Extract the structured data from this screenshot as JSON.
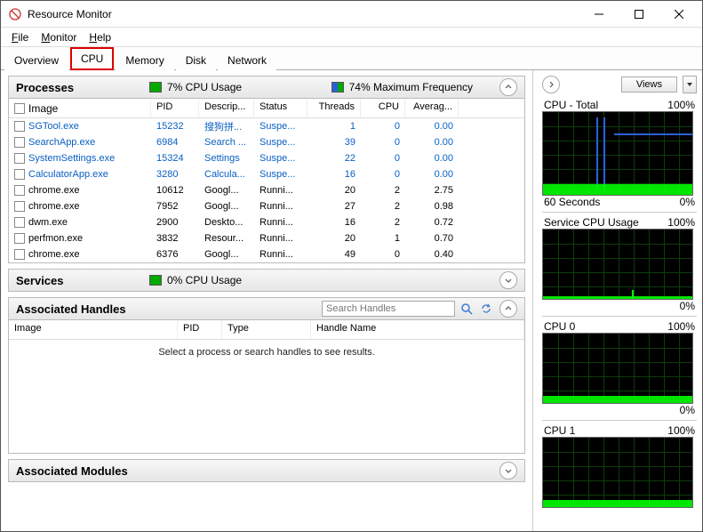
{
  "window": {
    "title": "Resource Monitor"
  },
  "menubar": {
    "file": "File",
    "monitor": "Monitor",
    "help": "Help"
  },
  "tabs": {
    "overview": "Overview",
    "cpu": "CPU",
    "memory": "Memory",
    "disk": "Disk",
    "network": "Network",
    "active": "cpu"
  },
  "processes": {
    "title": "Processes",
    "cpu_usage": "7% CPU Usage",
    "max_freq": "74% Maximum Frequency",
    "columns": {
      "image": "Image",
      "pid": "PID",
      "desc": "Descrip...",
      "status": "Status",
      "threads": "Threads",
      "cpu": "CPU",
      "avg": "Averag..."
    },
    "rows": [
      {
        "image": "SGTool.exe",
        "pid": "15232",
        "desc": "搜狗拼...",
        "status": "Suspe...",
        "threads": "1",
        "cpu": "0",
        "avg": "0.00",
        "blue": true
      },
      {
        "image": "SearchApp.exe",
        "pid": "6984",
        "desc": "Search ...",
        "status": "Suspe...",
        "threads": "39",
        "cpu": "0",
        "avg": "0.00",
        "blue": true
      },
      {
        "image": "SystemSettings.exe",
        "pid": "15324",
        "desc": "Settings",
        "status": "Suspe...",
        "threads": "22",
        "cpu": "0",
        "avg": "0.00",
        "blue": true
      },
      {
        "image": "CalculatorApp.exe",
        "pid": "3280",
        "desc": "Calcula...",
        "status": "Suspe...",
        "threads": "16",
        "cpu": "0",
        "avg": "0.00",
        "blue": true
      },
      {
        "image": "chrome.exe",
        "pid": "10612",
        "desc": "Googl...",
        "status": "Runni...",
        "threads": "20",
        "cpu": "2",
        "avg": "2.75",
        "blue": false
      },
      {
        "image": "chrome.exe",
        "pid": "7952",
        "desc": "Googl...",
        "status": "Runni...",
        "threads": "27",
        "cpu": "2",
        "avg": "0.98",
        "blue": false
      },
      {
        "image": "dwm.exe",
        "pid": "2900",
        "desc": "Deskto...",
        "status": "Runni...",
        "threads": "16",
        "cpu": "2",
        "avg": "0.72",
        "blue": false
      },
      {
        "image": "perfmon.exe",
        "pid": "3832",
        "desc": "Resour...",
        "status": "Runni...",
        "threads": "20",
        "cpu": "1",
        "avg": "0.70",
        "blue": false
      },
      {
        "image": "chrome.exe",
        "pid": "6376",
        "desc": "Googl...",
        "status": "Runni...",
        "threads": "49",
        "cpu": "0",
        "avg": "0.40",
        "blue": false
      }
    ]
  },
  "services": {
    "title": "Services",
    "cpu_usage": "0% CPU Usage"
  },
  "handles": {
    "title": "Associated Handles",
    "search_placeholder": "Search Handles",
    "columns": {
      "image": "Image",
      "pid": "PID",
      "type": "Type",
      "name": "Handle Name"
    },
    "empty": "Select a process or search handles to see results."
  },
  "modules": {
    "title": "Associated Modules"
  },
  "right": {
    "views": "Views",
    "charts": [
      {
        "title": "CPU - Total",
        "right": "100%",
        "foot_l": "60 Seconds",
        "foot_r": "0%"
      },
      {
        "title": "Service CPU Usage",
        "right": "100%",
        "foot_l": "",
        "foot_r": "0%"
      },
      {
        "title": "CPU 0",
        "right": "100%",
        "foot_l": "",
        "foot_r": "0%"
      },
      {
        "title": "CPU 1",
        "right": "100%",
        "foot_l": "",
        "foot_r": ""
      }
    ]
  }
}
